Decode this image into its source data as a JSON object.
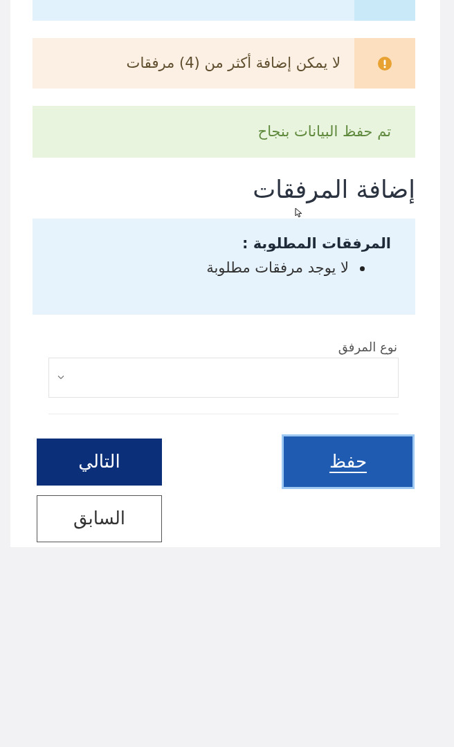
{
  "alerts": [
    {
      "kind": "info"
    },
    {
      "kind": "warning",
      "text": "لا يمكن إضافة أكثر من (4) مرفقات"
    },
    {
      "kind": "success",
      "text": "تم حفظ البيانات بنجاح"
    }
  ],
  "section_title": "إضافة المرفقات",
  "required_box": {
    "title": "المرفقات المطلوبة :",
    "items": [
      "لا يوجد مرفقات مطلوبة"
    ]
  },
  "attachment_type": {
    "label": "نوع المرفق"
  },
  "buttons": [
    {
      "kind": "primary",
      "label": "حفظ",
      "focused": true
    },
    {
      "kind": "dark",
      "label": "التالي",
      "focused": false
    },
    {
      "kind": "outline",
      "label": "السابق",
      "focused": false
    }
  ]
}
